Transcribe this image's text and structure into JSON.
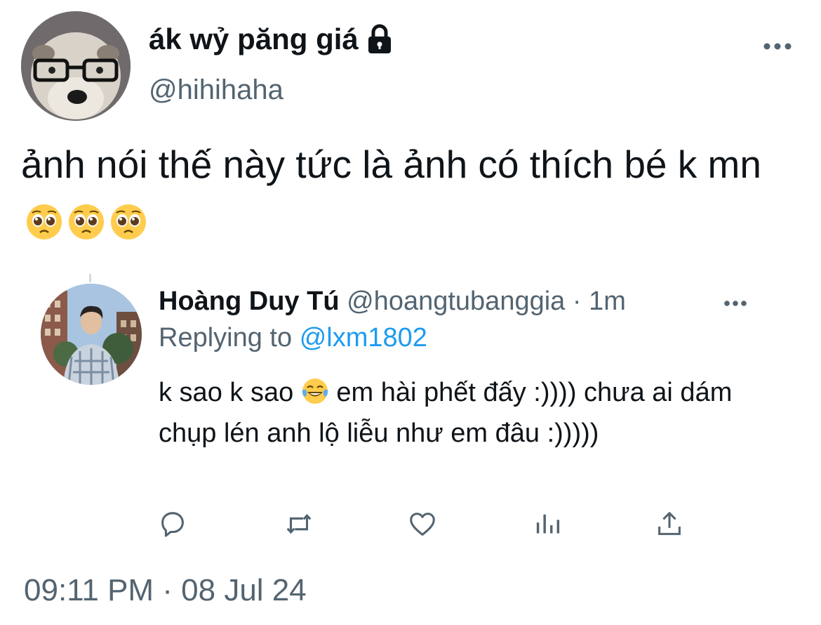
{
  "main_tweet": {
    "display_name": "ák wỷ păng giá",
    "handle": "@hihihaha",
    "text": "ảnh nói thế này tức là ảnh có thích bé k mn",
    "emojis": [
      "pleading-face",
      "pleading-face",
      "pleading-face"
    ]
  },
  "reply": {
    "display_name": "Hoàng Duy Tú",
    "handle": "@hoangtubanggia",
    "separator": "·",
    "time_ago": "1m",
    "replying_prefix": "Replying to",
    "replying_to": "@lxm1802",
    "text_before_emoji": "k sao k sao",
    "emoji": "face-with-tears-of-joy",
    "text_after_emoji": "em hài phết đấy :)))) chưa ai dám chụp lén anh lộ liễu như em đâu :)))))"
  },
  "actions": [
    {
      "name": "reply",
      "icon": "reply-icon"
    },
    {
      "name": "retweet",
      "icon": "retweet-icon"
    },
    {
      "name": "like",
      "icon": "heart-icon"
    },
    {
      "name": "analytics",
      "icon": "analytics-icon"
    },
    {
      "name": "share",
      "icon": "share-icon"
    }
  ],
  "timestamp": "09:11 PM · 08 Jul 24",
  "colors": {
    "text_primary": "#0f1419",
    "text_secondary": "#536471",
    "link": "#1d9bf0",
    "background": "#ffffff"
  }
}
